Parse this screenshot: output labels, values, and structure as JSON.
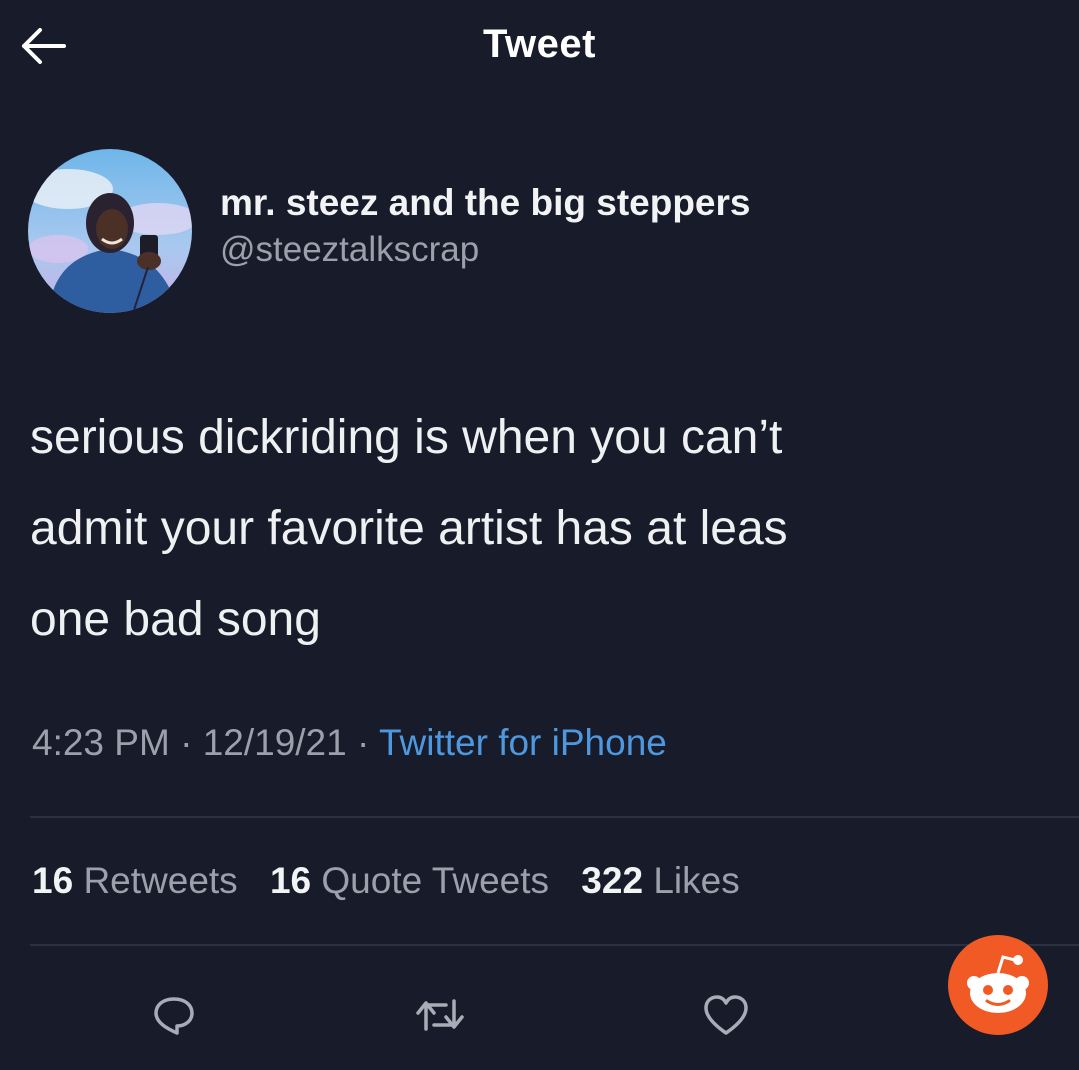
{
  "header": {
    "title": "Tweet",
    "back_icon": "arrow-left-icon"
  },
  "tweet": {
    "author": {
      "display_name": "mr. steez and the big steppers",
      "handle": "@steeztalkscrap"
    },
    "text_lines": [
      "serious dickriding is when you can’t",
      "admit your favorite artist has at leas",
      "one bad song"
    ],
    "time": "4:23 PM",
    "separator": "·",
    "date": "12/19/21",
    "source": "Twitter for iPhone",
    "stats": {
      "retweets_count": "16",
      "retweets_label": "Retweets",
      "quotes_count": "16",
      "quotes_label": "Quote Tweets",
      "likes_count": "322",
      "likes_label": "Likes"
    },
    "actions": [
      "reply-icon",
      "retweet-icon",
      "like-icon"
    ]
  },
  "colors": {
    "background": "#171b2a",
    "link": "#4e98e0",
    "secondary_text": "#9aa1ab",
    "reddit_badge": "#f15a24"
  },
  "overlay": {
    "icon": "reddit-snoo-icon"
  }
}
